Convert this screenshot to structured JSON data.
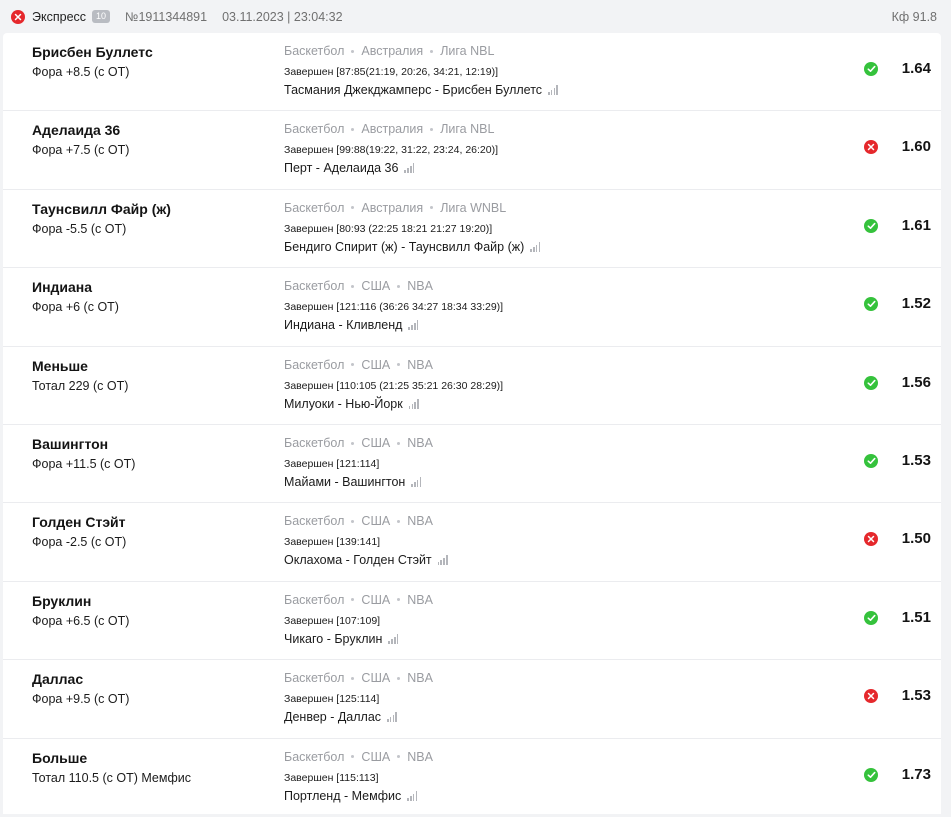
{
  "header": {
    "status": "loss",
    "status_icon": "x-circle-icon",
    "title": "Экспресс",
    "count_badge": "10",
    "bet_number": "№1911344891",
    "datetime": "03.11.2023 | 23:04:32",
    "total_coef": "Кф 91.8"
  },
  "colors": {
    "win": "#35c23c",
    "loss": "#e5282c"
  },
  "bets": [
    {
      "outcome": "Брисбен Буллетс",
      "market": "Фора +8.5 (с ОТ)",
      "sport": "Баскетбол",
      "country": "Австралия",
      "league": "Лига NBL",
      "result": "Завершен [87:85(21:19, 20:26, 34:21, 12:19)]",
      "match": "Тасмания Джекджамперс - Брисбен Буллетс",
      "status": "win",
      "coef": "1.64"
    },
    {
      "outcome": "Аделаида 36",
      "market": "Фора +7.5 (с ОТ)",
      "sport": "Баскетбол",
      "country": "Австралия",
      "league": "Лига NBL",
      "result": "Завершен [99:88(19:22, 31:22, 23:24, 26:20)]",
      "match": "Перт - Аделаида 36",
      "status": "loss",
      "coef": "1.60"
    },
    {
      "outcome": "Таунсвилл Файр (ж)",
      "market": "Фора -5.5 (с ОТ)",
      "sport": "Баскетбол",
      "country": "Австралия",
      "league": "Лига WNBL",
      "result": "Завершен [80:93 (22:25 18:21 21:27 19:20)]",
      "match": "Бендиго Спирит (ж) - Таунсвилл Файр (ж)",
      "status": "win",
      "coef": "1.61"
    },
    {
      "outcome": "Индиана",
      "market": "Фора +6 (с ОТ)",
      "sport": "Баскетбол",
      "country": "США",
      "league": "NBA",
      "result": "Завершен [121:116 (36:26 34:27 18:34 33:29)]",
      "match": "Индиана - Кливленд",
      "status": "win",
      "coef": "1.52"
    },
    {
      "outcome": "Меньше",
      "market": "Тотал 229 (с ОТ)",
      "sport": "Баскетбол",
      "country": "США",
      "league": "NBA",
      "result": "Завершен [110:105 (21:25 35:21 26:30 28:29)]",
      "match": "Милуоки - Нью-Йорк",
      "status": "win",
      "coef": "1.56"
    },
    {
      "outcome": "Вашингтон",
      "market": "Фора +11.5 (с ОТ)",
      "sport": "Баскетбол",
      "country": "США",
      "league": "NBA",
      "result": "Завершен [121:114]",
      "match": "Майами - Вашингтон",
      "status": "win",
      "coef": "1.53"
    },
    {
      "outcome": "Голден Стэйт",
      "market": "Фора -2.5 (с ОТ)",
      "sport": "Баскетбол",
      "country": "США",
      "league": "NBA",
      "result": "Завершен [139:141]",
      "match": "Оклахома - Голден Стэйт",
      "status": "loss",
      "coef": "1.50"
    },
    {
      "outcome": "Бруклин",
      "market": "Фора +6.5 (с ОТ)",
      "sport": "Баскетбол",
      "country": "США",
      "league": "NBA",
      "result": "Завершен [107:109]",
      "match": "Чикаго - Бруклин",
      "status": "win",
      "coef": "1.51"
    },
    {
      "outcome": "Даллас",
      "market": "Фора +9.5 (с ОТ)",
      "sport": "Баскетбол",
      "country": "США",
      "league": "NBA",
      "result": "Завершен [125:114]",
      "match": "Денвер - Даллас",
      "status": "loss",
      "coef": "1.53"
    },
    {
      "outcome": "Больше",
      "market": "Тотал 110.5 (с ОТ) Мемфис",
      "sport": "Баскетбол",
      "country": "США",
      "league": "NBA",
      "result": "Завершен [115:113]",
      "match": "Портленд - Мемфис",
      "status": "win",
      "coef": "1.73"
    }
  ]
}
